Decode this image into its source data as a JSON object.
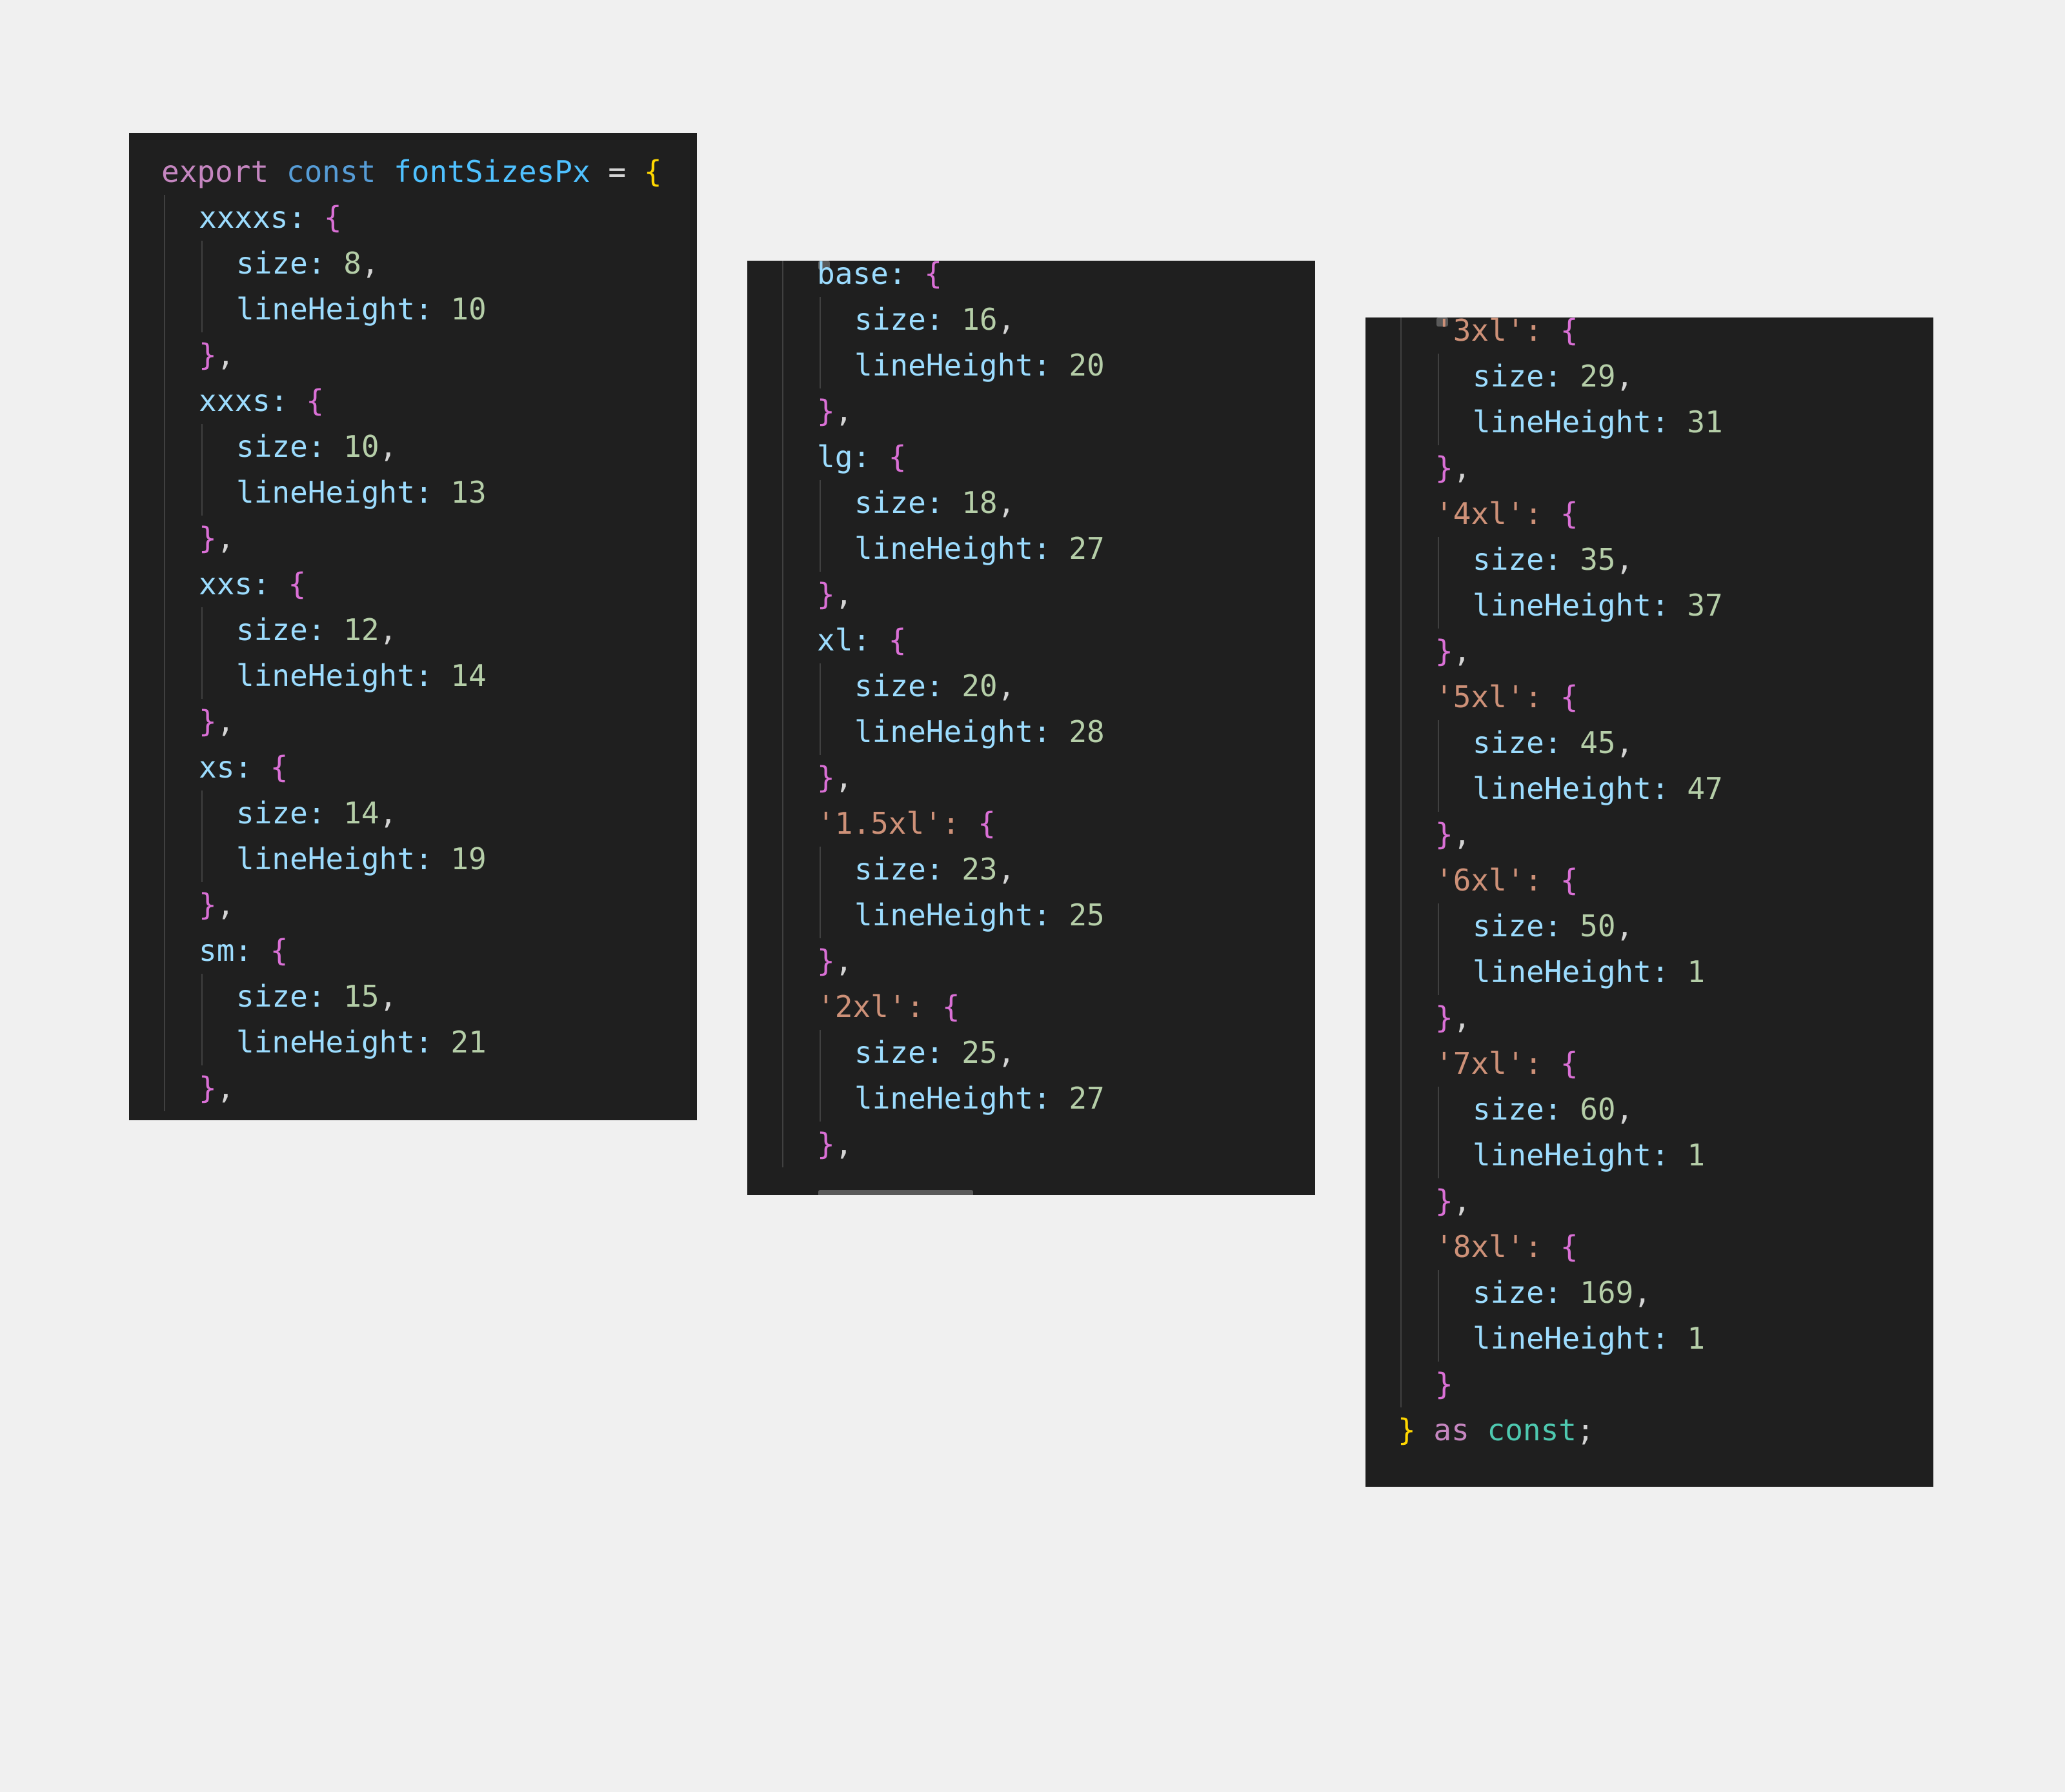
{
  "code": {
    "header": {
      "export_kw": "export",
      "const_kw": "const",
      "name": "fontSizesPx",
      "equals": "=",
      "open": "{"
    },
    "footer": {
      "close": "}",
      "as_kw": "as",
      "const_kw": "const",
      "semicolon": ";"
    },
    "labels": {
      "size": "size:",
      "line_height": "lineHeight:"
    },
    "entries": [
      {
        "key": "xxxxs:",
        "size": "8",
        "lineHeight": "10"
      },
      {
        "key": "xxxs:",
        "size": "10",
        "lineHeight": "13"
      },
      {
        "key": "xxs:",
        "size": "12",
        "lineHeight": "14"
      },
      {
        "key": "xs:",
        "size": "14",
        "lineHeight": "19"
      },
      {
        "key": "sm:",
        "size": "15",
        "lineHeight": "21"
      },
      {
        "key": "base:",
        "size": "16",
        "lineHeight": "20"
      },
      {
        "key": "lg:",
        "size": "18",
        "lineHeight": "27"
      },
      {
        "key": "xl:",
        "size": "20",
        "lineHeight": "28"
      },
      {
        "key": "'1.5xl':",
        "size": "23",
        "lineHeight": "25"
      },
      {
        "key": "'2xl':",
        "size": "25",
        "lineHeight": "27"
      },
      {
        "key": "'3xl':",
        "size": "29",
        "lineHeight": "31"
      },
      {
        "key": "'4xl':",
        "size": "35",
        "lineHeight": "37"
      },
      {
        "key": "'5xl':",
        "size": "45",
        "lineHeight": "47"
      },
      {
        "key": "'6xl':",
        "size": "50",
        "lineHeight": "1"
      },
      {
        "key": "'7xl':",
        "size": "60",
        "lineHeight": "1"
      },
      {
        "key": "'8xl':",
        "size": "169",
        "lineHeight": "1"
      }
    ]
  },
  "colors": {
    "page_background": "#f0f0f0",
    "editor_background": "#1f1f1f",
    "keyword_export": "#c586c0",
    "keyword_const": "#569cd6",
    "identifier": "#4fc1ff",
    "outer_brace": "#ffd700",
    "inner_brace": "#da70d6",
    "property": "#9cdcfe",
    "string": "#ce9178",
    "number": "#b5cea8",
    "type_keyword": "#4ec9b0"
  }
}
